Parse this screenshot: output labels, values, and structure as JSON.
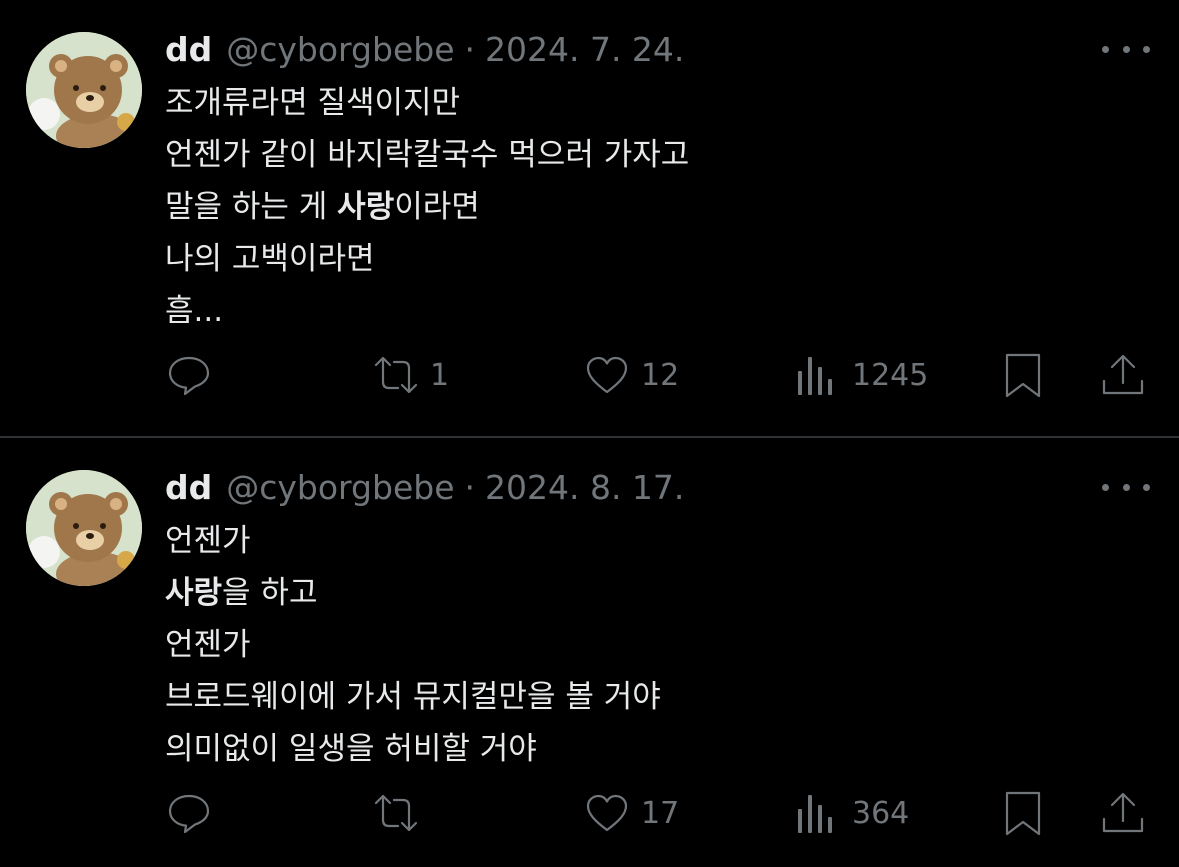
{
  "tweets": [
    {
      "name": "dd",
      "handle": "@cyborgbebe",
      "separator": "·",
      "date": "2024. 7. 24.",
      "lines": [
        [
          {
            "text": "조개류라면 질색이지만",
            "bold": false
          }
        ],
        [
          {
            "text": "언젠가 같이 바지락칼국수 먹으러 가자고",
            "bold": false
          }
        ],
        [
          {
            "text": "말을 하는 게 ",
            "bold": false
          },
          {
            "text": "사랑",
            "bold": true
          },
          {
            "text": "이라면",
            "bold": false
          }
        ],
        [
          {
            "text": "나의 고백이라면",
            "bold": false
          }
        ],
        [
          {
            "text": "흠...",
            "bold": false
          }
        ]
      ],
      "stats": {
        "replies": "",
        "retweets": "1",
        "likes": "12",
        "views": "1245"
      }
    },
    {
      "name": "dd",
      "handle": "@cyborgbebe",
      "separator": "·",
      "date": "2024. 8. 17.",
      "lines": [
        [
          {
            "text": "언젠가",
            "bold": false
          }
        ],
        [
          {
            "text": "사랑",
            "bold": true
          },
          {
            "text": "을 하고",
            "bold": false
          }
        ],
        [
          {
            "text": "언젠가",
            "bold": false
          }
        ],
        [
          {
            "text": "브로드웨이에 가서 뮤지컬만을 볼 거야",
            "bold": false
          }
        ],
        [
          {
            "text": "의미없이 일생을 허비할 거야",
            "bold": false
          }
        ]
      ],
      "stats": {
        "replies": "",
        "retweets": "",
        "likes": "17",
        "views": "364"
      }
    }
  ],
  "icons": {
    "reply": "speech-bubble-icon",
    "retweet": "retweet-arrows-icon",
    "like": "heart-outline-icon",
    "views": "bar-chart-icon",
    "bookmark": "bookmark-icon",
    "share": "share-upload-icon",
    "more": "more-horizontal-dots-icon"
  },
  "colors": {
    "background": "#000000",
    "primary_text": "#e7e9ea",
    "secondary_text": "#71767b",
    "divider": "#2f3336"
  }
}
